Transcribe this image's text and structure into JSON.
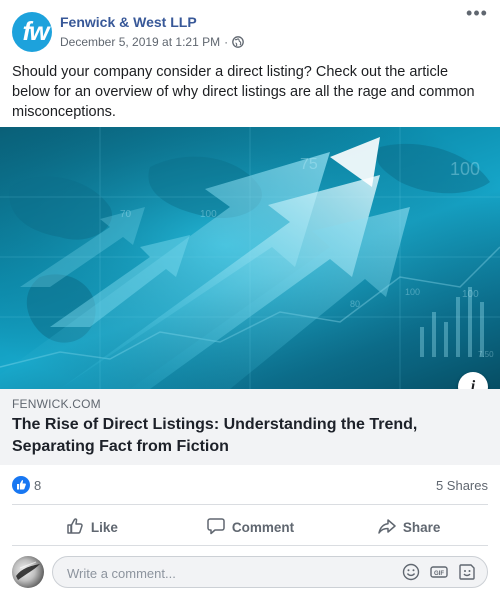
{
  "post": {
    "page_name": "Fenwick & West LLP",
    "avatar_initials": "fw",
    "date": "December 5, 2019 at 1:21 PM",
    "separator": "·",
    "more_label": "•••",
    "text": "Should your company consider a direct listing? Check out the article below for an overview of why direct listings are all the rage and common misconceptions."
  },
  "link_preview": {
    "domain": "FENWICK.COM",
    "title": "The Rise of Direct Listings: Understanding the Trend, Separating Fact from Fiction",
    "info_label": "i",
    "image_numbers": [
      "75",
      "100",
      "70",
      "100",
      "100",
      "80",
      "100",
      "7.50"
    ]
  },
  "stats": {
    "like_count": "8",
    "shares": "5 Shares"
  },
  "actions": {
    "like": "Like",
    "comment": "Comment",
    "share": "Share"
  },
  "comment": {
    "placeholder": "Write a comment..."
  },
  "icons": {
    "globe": "globe-icon",
    "like": "thumbs-up-icon",
    "comment": "speech-bubble-icon",
    "share": "share-arrow-icon",
    "emoji": "smiley-icon",
    "gif": "gif-icon",
    "sticker": "sticker-icon"
  },
  "colors": {
    "brand": "#385898",
    "like_blue": "#1877f2",
    "avatar": "#1da2dc"
  }
}
